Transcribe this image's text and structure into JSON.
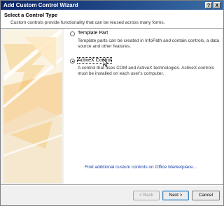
{
  "window": {
    "title": "Add Custom Control Wizard",
    "help_label": "?",
    "close_label": "X"
  },
  "header": {
    "title": "Select a Control Type",
    "subtitle": "Custom controls provide functionality that can be reused across many forms."
  },
  "options": [
    {
      "label": "Template Part",
      "description": "Template parts can be created in InfoPath and contain controls, a data source and other features.",
      "selected": false
    },
    {
      "label": "ActiveX Control",
      "description": "A control that uses COM and ActiveX technologies. ActiveX controls must be installed on each user's computer.",
      "selected": true
    }
  ],
  "link": {
    "text": "Find additional custom controls on Office Marketplace..."
  },
  "buttons": {
    "back": "< Back",
    "next": "Next >",
    "cancel": "Cancel"
  },
  "colors": {
    "title_bar": "#0a246a",
    "link": "#1a41a8",
    "art_accent": "#f5a623"
  },
  "icons": [
    "help-icon",
    "close-icon",
    "mouse-cursor-icon"
  ]
}
